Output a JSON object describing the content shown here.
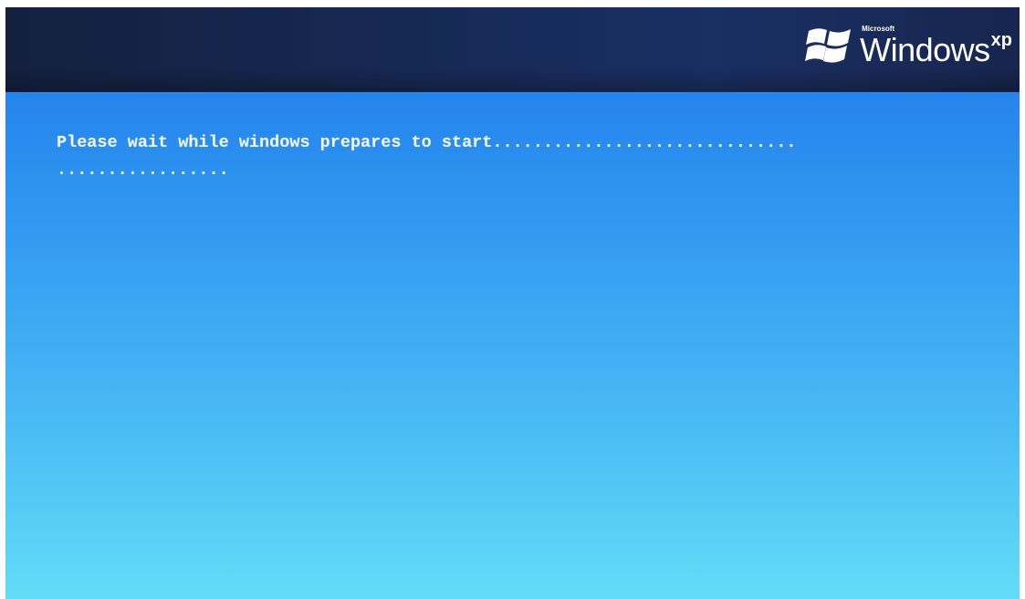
{
  "header": {
    "logo": {
      "microsoft_label": "Microsoft",
      "windows_label": "Windows",
      "xp_label": "xp",
      "flag_colors": [
        "#ffffff",
        "#ffffff",
        "#ffffff",
        "#ffffff"
      ]
    }
  },
  "boot": {
    "message_line_1": "Please wait while windows prepares to start..............................",
    "message_line_2": ".................",
    "background_top_color": "#1f77ea",
    "background_bottom_color": "#62dcf6",
    "bar_color": "#162955"
  }
}
